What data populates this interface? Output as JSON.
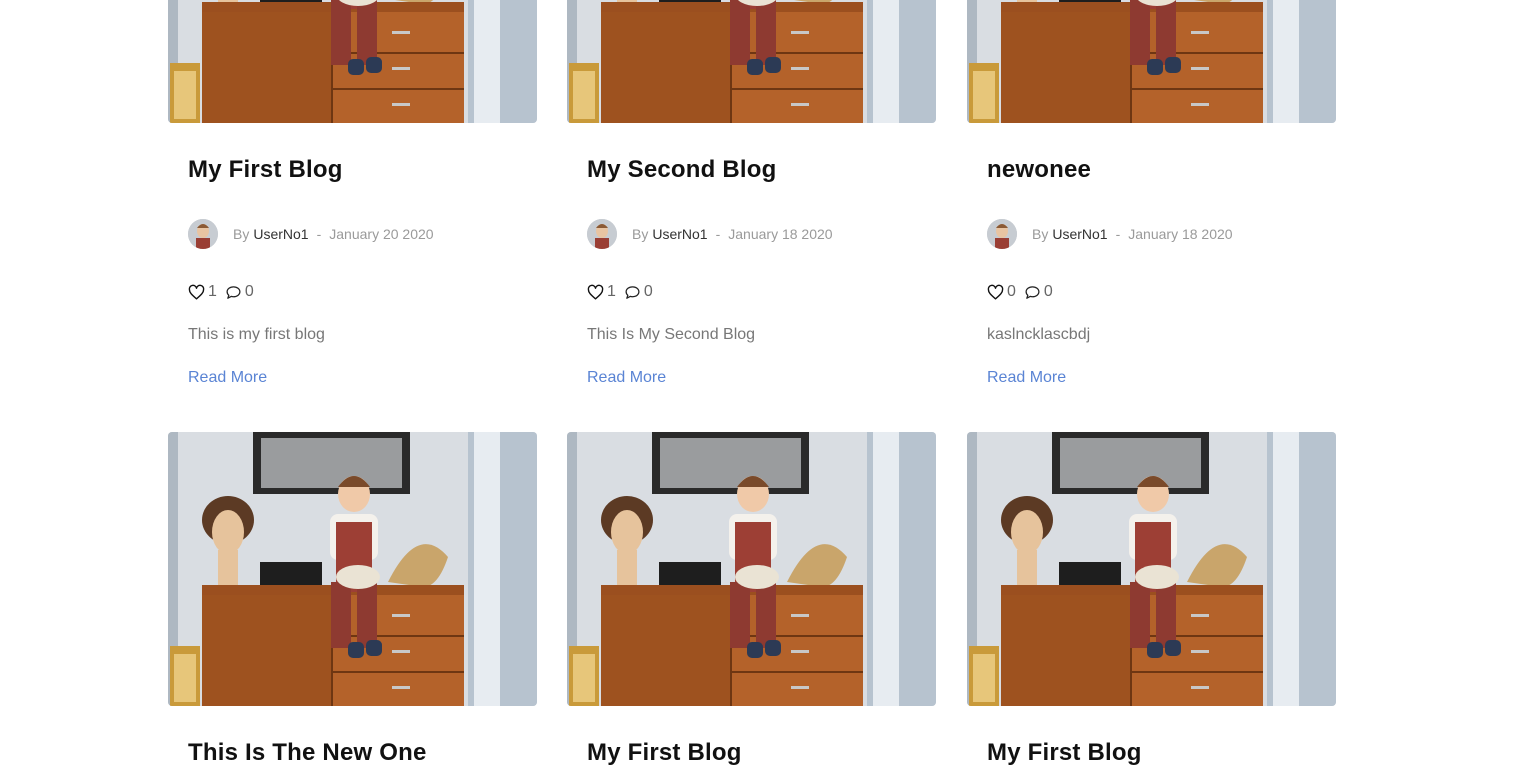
{
  "posts": [
    {
      "title": "My First Blog",
      "by_label": "By",
      "author": "UserNo1",
      "separator": "-",
      "date": "January 20 2020",
      "likes": "1",
      "comments": "0",
      "excerpt": "This is my first blog",
      "read_more": "Read More"
    },
    {
      "title": "My Second Blog",
      "by_label": "By",
      "author": "UserNo1",
      "separator": "-",
      "date": "January 18 2020",
      "likes": "1",
      "comments": "0",
      "excerpt": "This Is My Second Blog",
      "read_more": "Read More"
    },
    {
      "title": "newonee",
      "by_label": "By",
      "author": "UserNo1",
      "separator": "-",
      "date": "January 18 2020",
      "likes": "0",
      "comments": "0",
      "excerpt": "kaslncklascbdj",
      "read_more": "Read More"
    },
    {
      "title": "This Is The New One"
    },
    {
      "title": "My First Blog"
    },
    {
      "title": "My First Blog"
    }
  ],
  "icons": {
    "like": "heart-outline-icon",
    "comment": "speech-bubble-icon"
  },
  "colors": {
    "link": "#5a84d4",
    "title": "#111111",
    "meta": "#9a9a9a",
    "author": "#333333",
    "text": "#777777"
  }
}
